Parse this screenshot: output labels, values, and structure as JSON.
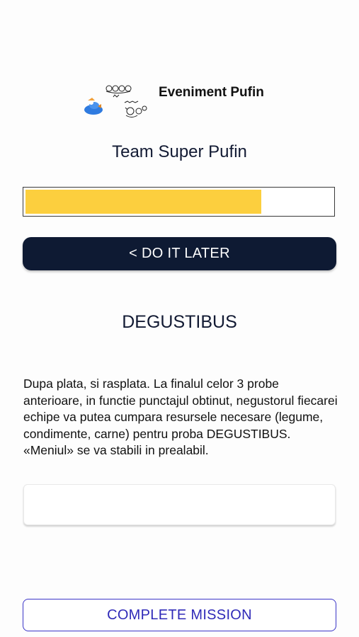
{
  "header": {
    "event_title": "Eveniment Pufin",
    "logo_icon": "pufin-event-logo"
  },
  "team": {
    "name": "Team Super Pufin"
  },
  "progress": {
    "fraction": 0.77,
    "fill_color": "#fccf3e"
  },
  "actions": {
    "later_label": "< DO IT LATER",
    "complete_label": "COMPLETE MISSION"
  },
  "mission": {
    "title": "DEGUSTIBUS",
    "description": "Dupa plata, si rasplata. La finalul celor 3 probe anterioare, in functie punctajul obtinut, negustorul fiecarei echipe va putea cumpara resursele necesare (legume, condimente, carne) pentru proba DEGUSTIBUS. «Meniul» se va stabili in prealabil.",
    "answer_value": ""
  },
  "colors": {
    "dark_button": "#0e1a33",
    "accent": "#2f2ab8"
  }
}
